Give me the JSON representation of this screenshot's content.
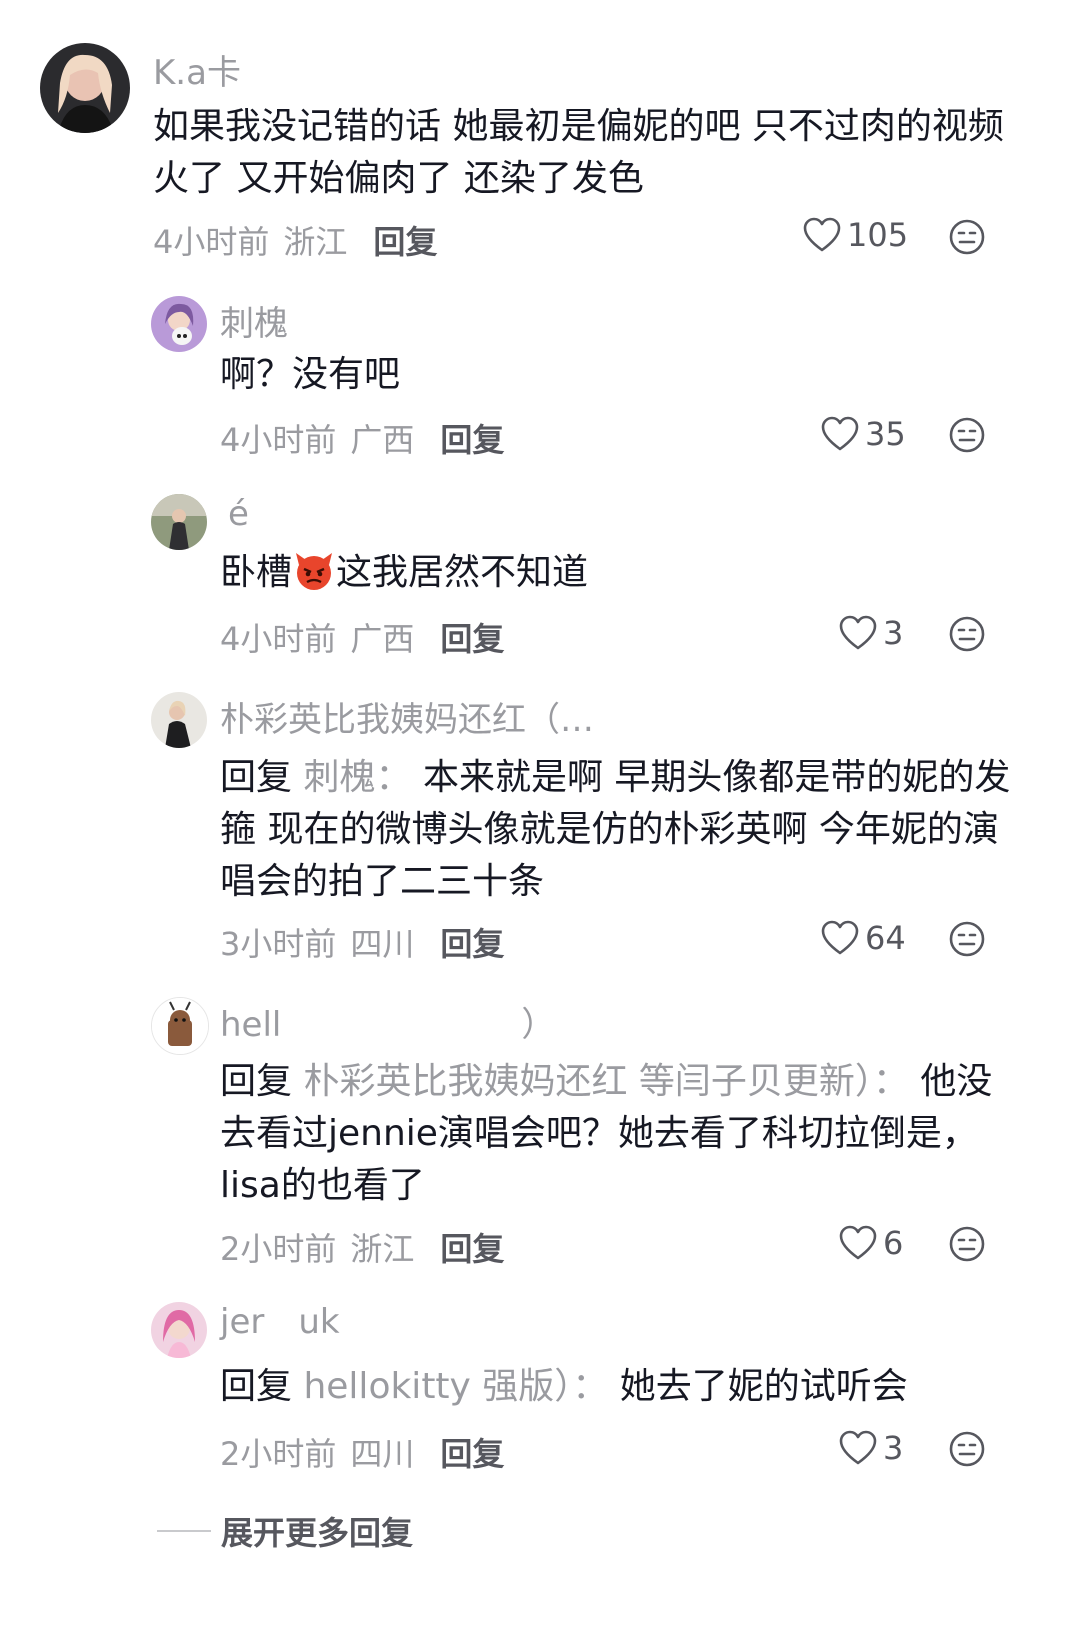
{
  "comments": [
    {
      "username": "K.a卡",
      "text": "如果我没记错的话  她最初是偏妮的吧  只不过肉的视频火了 又开始偏肉了  还染了发色",
      "time": "4小时前",
      "location": "浙江",
      "reply_label": "回复",
      "likes": "105"
    },
    {
      "username": "刺槐",
      "text": "啊？没有吧",
      "time": "4小时前",
      "location": "广西",
      "reply_label": "回复",
      "likes": "35"
    },
    {
      "username": "é",
      "text_before": "卧槽",
      "text_after": "这我居然不知道",
      "emoji": "angry-devil-emoji",
      "time": "4小时前",
      "location": "广西",
      "reply_label": "回复",
      "likes": "3"
    },
    {
      "username": "朴彩英比我姨妈还红（…",
      "reply_prefix": "回复",
      "reply_target": "刺槐：",
      "text": "本来就是啊 早期头像都是带的妮的发箍  现在的微博头像就是仿的朴彩英啊  今年妮的演唱会的拍了二三十条",
      "time": "3小时前",
      "location": "四川",
      "reply_label": "回复",
      "likes": "64"
    },
    {
      "username": "hell",
      "username_tail": "）",
      "reply_prefix": "回复",
      "reply_target": "朴彩英比我姨妈还红    等闫子贝更新）：",
      "text": "他没去看过jennie演唱会吧？她去看了科切拉倒是，lisa的也看了",
      "time": "2小时前",
      "location": "浙江",
      "reply_label": "回复",
      "likes": "6"
    },
    {
      "username": "jer",
      "username_tail": "uk",
      "reply_prefix": "回复",
      "reply_target": "hellokitty      强版）：",
      "text": "她去了妮的试听会",
      "time": "2小时前",
      "location": "四川",
      "reply_label": "回复",
      "likes": "3"
    }
  ],
  "expand_more": "展开更多回复",
  "icons": {
    "like": "heart-outline-icon",
    "react": "emoji-face-icon"
  },
  "colors": {
    "text": "#161823",
    "muted": "#9a9ba0",
    "action": "#56575e"
  }
}
